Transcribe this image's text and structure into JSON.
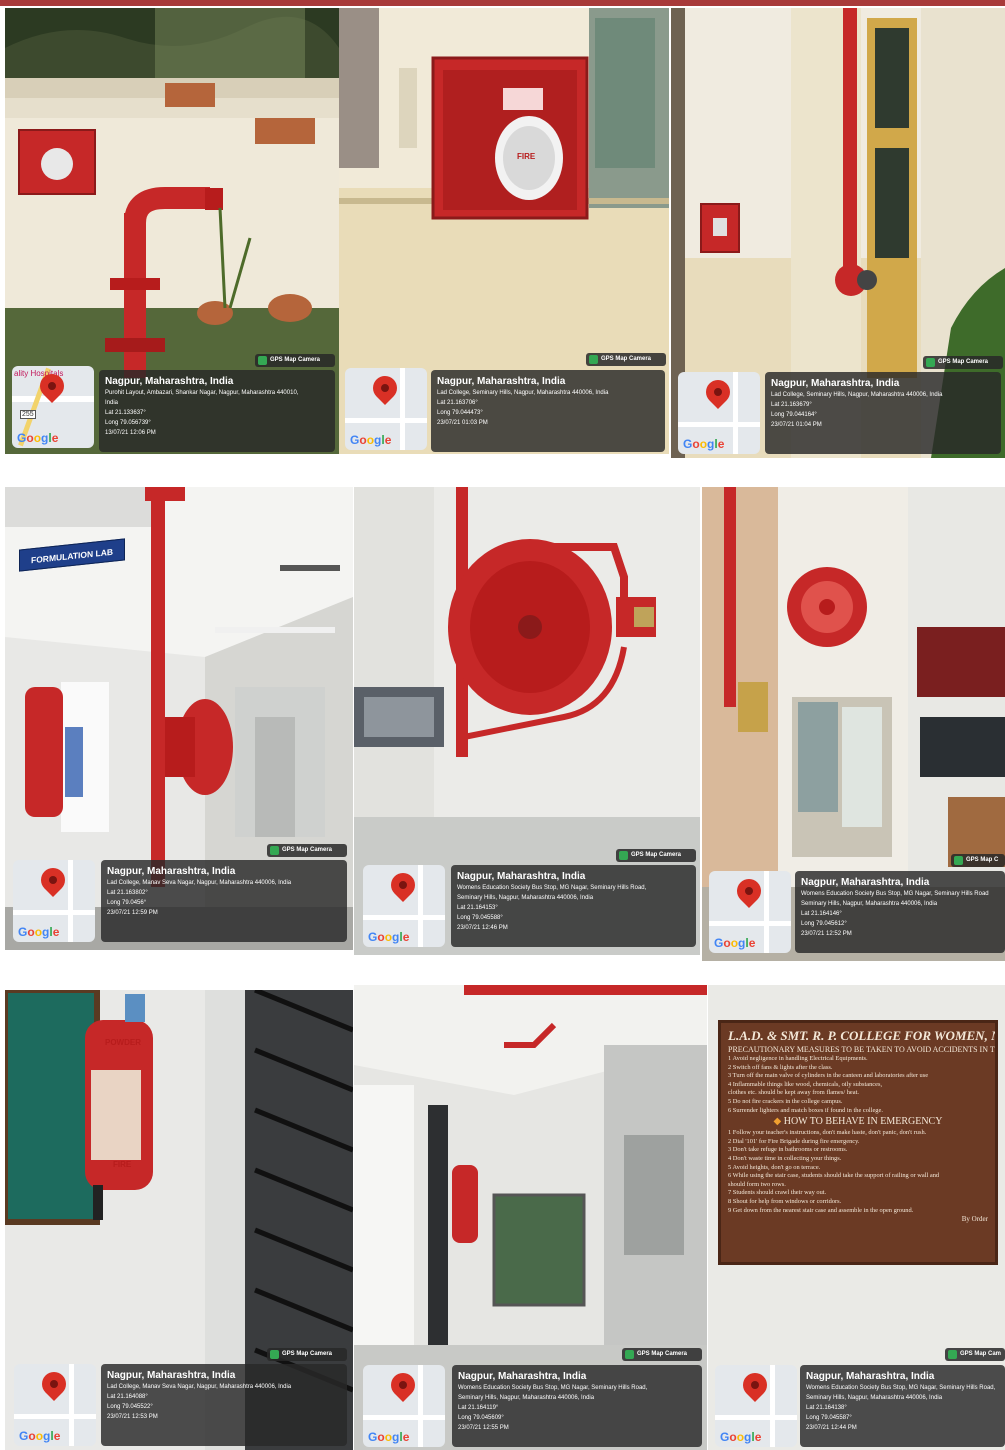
{
  "photos": [
    {
      "city": "Nagpur, Maharashtra, India",
      "address": "Purohit Layout, Ambazari, Shankar Nagar, Nagpur, Maharashtra 440010,",
      "address2": "India",
      "lat": "Lat 21.133637°",
      "long": "Long 79.056739°",
      "datetime": "13/07/21 12:06 PM",
      "badge": "GPS Map Camera",
      "map_poi": "ality Hospitals",
      "map_road": "255"
    },
    {
      "city": "Nagpur, Maharashtra, India",
      "address": "Lad College, Seminary Hills, Nagpur, Maharashtra 440006, India",
      "lat": "Lat 21.163706°",
      "long": "Long 79.044473°",
      "datetime": "23/07/21 01:03 PM",
      "badge": "GPS Map Camera",
      "fire_text": "FIRE"
    },
    {
      "city": "Nagpur, Maharashtra, India",
      "address": "Lad College, Seminary Hills, Nagpur, Maharashtra 440006, India",
      "lat": "Lat 21.163679°",
      "long": "Long 79.044164°",
      "datetime": "23/07/21 01:04 PM",
      "badge": "GPS Map Camera"
    },
    {
      "city": "Nagpur, Maharashtra, India",
      "address": "Lad College, Manav Seva Nagar, Nagpur, Maharashtra 440006, India",
      "lat": "Lat 21.163802°",
      "long": "Long 79.0456°",
      "datetime": "23/07/21 12:59 PM",
      "badge": "GPS Map Camera",
      "sign": "FORMULATION LAB"
    },
    {
      "city": "Nagpur, Maharashtra, India",
      "address": "Womens Education Society Bus Stop, MG Nagar, Seminary Hills Road,",
      "address2": "Seminary Hills, Nagpur, Maharashtra 440006, India",
      "lat": "Lat 21.164153°",
      "long": "Long 79.045588°",
      "datetime": "23/07/21 12:46 PM",
      "badge": "GPS Map Camera"
    },
    {
      "city": "Nagpur, Maharashtra, India",
      "address": "Womens Education Society Bus Stop, MG Nagar, Seminary Hills Road",
      "address2": "Seminary Hills, Nagpur, Maharashtra 440006, India",
      "lat": "Lat 21.164146°",
      "long": "Long 79.045612°",
      "datetime": "23/07/21 12:52 PM",
      "badge": "GPS Map C"
    },
    {
      "city": "Nagpur, Maharashtra, India",
      "address": "Lad College, Manav Seva Nagar, Nagpur, Maharashtra 440006, India",
      "lat": "Lat 21.164088°",
      "long": "Long 79.045522°",
      "datetime": "23/07/21 12:53 PM",
      "badge": "GPS Map Camera",
      "fire_text": "FIRE",
      "powder_text": "POWDER"
    },
    {
      "city": "Nagpur, Maharashtra, India",
      "address": "Womens Education Society Bus Stop, MG Nagar, Seminary Hills Road,",
      "address2": "Seminary Hills, Nagpur, Maharashtra 440006, India",
      "lat": "Lat 21.164119°",
      "long": "Long 79.045609°",
      "datetime": "23/07/21 12:55 PM",
      "badge": "GPS Map Camera"
    },
    {
      "city": "Nagpur, Maharashtra, India",
      "address": "Womens Education Society Bus Stop, MG Nagar, Seminary Hills Road,",
      "address2": "Seminary Hills, Nagpur, Maharashtra 440006, India",
      "lat": "Lat 21.164138°",
      "long": "Long 79.045587°",
      "datetime": "23/07/21 12:44 PM",
      "badge": "GPS Map Cam"
    }
  ],
  "google": [
    "G",
    "o",
    "o",
    "g",
    "l",
    "e"
  ],
  "notice": {
    "title": "L.A.D. & SMT. R. P. COLLEGE FOR WOMEN, NAGPUR.",
    "subtitle": "PRECAUTIONARY MEASURES TO BE TAKEN TO AVOID ACCIDENTS IN THE COLLEGE",
    "precautions": [
      "1 Avoid negligence in handling Electrical Equipments.",
      "2 Switch off fans & lights after the class.",
      "3 Turn off the main valve of cylinders in the canteen and laboratories after use",
      "4 Inflammable things like wood, chemicals, oily substances,",
      "   clothes etc. should be kept away from flames/ heat.",
      "5 Do not fire crackers in the college campus.",
      "6 Surrender lighters and match boxes if found in the college."
    ],
    "emergency_heading": "HOW TO BEHAVE IN EMERGENCY",
    "emergency": [
      "1 Follow your teacher's instructions, don't make haste, don't panic, don't rush.",
      "2 Dial '101' for Fire Brigade during fire emergency.",
      "3 Don't take refuge in bathrooms or restrooms.",
      "4 Don't waste time in collecting your things.",
      "5 Avoid heights, don't go on terrace.",
      "6 While using the stair case, students should take the support of railing or wall and",
      "   should form two rows.",
      "7 Students should crawl their way out.",
      "8 Shout for help from windows or corridors.",
      "9 Get down from the nearest stair case and assemble in the open ground."
    ],
    "by_order": "By Order"
  },
  "colors": {
    "fire_red": "#c62828",
    "stamp_bg": "#282828",
    "board_brown": "#6b3a24",
    "sign_blue": "#1f3f8a"
  }
}
